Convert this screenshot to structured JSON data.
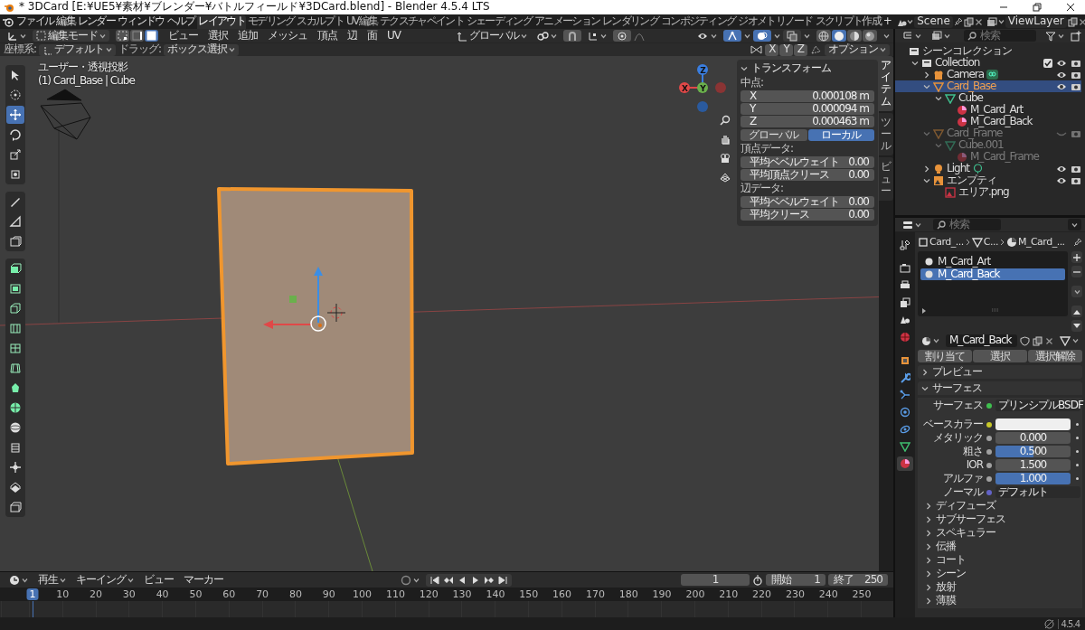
{
  "window": {
    "title": "* 3DCard [E:¥UE5¥素材¥ブレンダー¥バトルフィールド¥3DCard.blend] - Blender 4.5.4 LTS"
  },
  "menu": [
    "ファイル",
    "編集",
    "レンダー",
    "ウィンドウ",
    "ヘルプ"
  ],
  "workspaces": [
    {
      "label": "レイアウト",
      "selected": true
    },
    {
      "label": "モデリング",
      "selected": false
    },
    {
      "label": "スカルプト",
      "selected": false
    },
    {
      "label": "UV編集",
      "selected": false
    },
    {
      "label": "テクスチャペイント",
      "selected": false
    },
    {
      "label": "シェーディング",
      "selected": false
    },
    {
      "label": "アニメーション",
      "selected": false
    },
    {
      "label": "レンダリング",
      "selected": false
    },
    {
      "label": "コンポジティング",
      "selected": false
    },
    {
      "label": "ジオメトリノード",
      "selected": false
    },
    {
      "label": "スクリプト作成",
      "selected": false
    }
  ],
  "add_workspace": "+",
  "scene": {
    "name": "Scene"
  },
  "view_layer": {
    "name": "ViewLayer"
  },
  "viewport_header": {
    "mode": "編集モード",
    "select_modes": [
      {
        "kind": "vertex",
        "selected": false
      },
      {
        "kind": "edge",
        "selected": false
      },
      {
        "kind": "face",
        "selected": true
      }
    ],
    "menus": [
      "ビュー",
      "選択",
      "追加",
      "メッシュ",
      "頂点",
      "辺",
      "面",
      "UV"
    ],
    "orientation": "グローバル",
    "snapping": {
      "on": false
    },
    "proportional_editing": {
      "on": false
    },
    "view_toggles": [
      {
        "kind": "gizmo",
        "on": true
      },
      {
        "kind": "overlay",
        "on": true
      },
      {
        "kind": "xray",
        "on": false
      }
    ],
    "shading": [
      {
        "kind": "wireframe",
        "selected": false
      },
      {
        "kind": "solid",
        "selected": true
      },
      {
        "kind": "material",
        "selected": false
      },
      {
        "kind": "rendered",
        "selected": false
      }
    ]
  },
  "tool_settings": {
    "coordinate_label": "座標系:",
    "coordinate_value": "デフォルト",
    "drag_label": "ドラッグ:",
    "drag_value": "ボックス選択",
    "mirror_axes": [
      {
        "label": "X",
        "selected": false
      },
      {
        "label": "Y",
        "selected": false
      },
      {
        "label": "Z",
        "selected": false
      }
    ],
    "options": "オプション"
  },
  "viewport": {
    "view_name": "ユーザー・透視投影",
    "object_info": "(1) Card_Base | Cube",
    "gizmo_axes": [
      "X",
      "Y",
      "Z"
    ]
  },
  "tool_groups": [
    [
      {
        "selected": false
      },
      {
        "selected": false
      },
      {
        "selected": true
      },
      {
        "selected": false
      },
      {
        "selected": false
      },
      {
        "selected": false
      }
    ],
    [
      {
        "selected": false
      },
      {
        "selected": false
      },
      {
        "selected": false
      }
    ],
    [
      {
        "selected": false
      },
      {
        "selected": false
      },
      {
        "selected": false
      },
      {
        "selected": false
      },
      {
        "selected": false
      },
      {
        "selected": false
      },
      {
        "selected": false
      },
      {
        "selected": false
      },
      {
        "selected": false
      },
      {
        "selected": false
      },
      {
        "selected": false
      },
      {
        "selected": false
      },
      {
        "selected": false
      }
    ]
  ],
  "n_panel": {
    "title": "トランスフォーム",
    "median_label": "中点:",
    "median": [
      {
        "axis": "X",
        "value": "0.000108 m"
      },
      {
        "axis": "Y",
        "value": "0.000094 m"
      },
      {
        "axis": "Z",
        "value": "0.000463 m"
      }
    ],
    "space": [
      {
        "label": "グローバル",
        "selected": false
      },
      {
        "label": "ローカル",
        "selected": true
      }
    ],
    "sections": [
      {
        "title": "頂点データ:",
        "fields": [
          {
            "label": "平均ベベルウェイト",
            "value": "0.00"
          },
          {
            "label": "平均頂点クリース",
            "value": "0.00"
          }
        ]
      },
      {
        "title": "辺データ:",
        "fields": [
          {
            "label": "平均ベベルウェイト",
            "value": "0.00"
          },
          {
            "label": "平均クリース",
            "value": "0.00"
          }
        ]
      }
    ]
  },
  "side_tabs": [
    {
      "label": "アイテム",
      "selected": true
    },
    {
      "label": "ツール",
      "selected": false
    },
    {
      "label": "ビュー",
      "selected": false
    }
  ],
  "outliner": {
    "search": {
      "placeholder": "検索"
    },
    "root": "シーンコレクション",
    "tree": [
      {
        "label": "Collection",
        "kind": "collection",
        "expanded": true,
        "selected": false,
        "checked": true,
        "visible": true,
        "children": [
          {
            "label": "Camera",
            "kind": "camera",
            "expanded": false,
            "selected": false,
            "visible": true
          },
          {
            "label": "Card_Base",
            "kind": "mesh_object",
            "expanded": true,
            "selected": true,
            "visible": true,
            "children": [
              {
                "label": "Cube",
                "kind": "mesh_data",
                "expanded": true,
                "selected": false,
                "children": [
                  {
                    "label": "M_Card_Art",
                    "kind": "material",
                    "selected": false
                  },
                  {
                    "label": "M_Card_Back",
                    "kind": "material",
                    "selected": false
                  }
                ]
              }
            ]
          },
          {
            "label": "Card_Frame",
            "kind": "mesh_object",
            "expanded": true,
            "selected": false,
            "visible": false,
            "children": [
              {
                "label": "Cube.001",
                "kind": "mesh_data",
                "expanded": true,
                "selected": false,
                "children": [
                  {
                    "label": "M_Card_Frame",
                    "kind": "material",
                    "selected": false
                  }
                ]
              }
            ]
          },
          {
            "label": "Light",
            "kind": "light",
            "expanded": false,
            "selected": false,
            "visible": true
          },
          {
            "label": "エンプティ",
            "kind": "empty",
            "expanded": true,
            "selected": false,
            "visible": true,
            "children": [
              {
                "label": "エリア.png",
                "kind": "image",
                "selected": false
              }
            ]
          }
        ]
      }
    ]
  },
  "properties": {
    "search": {
      "placeholder": "検索"
    },
    "tabs": [
      {
        "kind": "tool",
        "selected": false
      },
      {
        "kind": "render",
        "selected": false
      },
      {
        "kind": "output",
        "selected": false
      },
      {
        "kind": "view_layer",
        "selected": false
      },
      {
        "kind": "scene",
        "selected": false
      },
      {
        "kind": "world",
        "selected": false
      },
      {
        "kind": "object",
        "selected": false
      },
      {
        "kind": "modifier",
        "selected": false
      },
      {
        "kind": "particles",
        "selected": false
      },
      {
        "kind": "physics",
        "selected": false
      },
      {
        "kind": "constraints",
        "selected": false
      },
      {
        "kind": "data",
        "selected": false
      },
      {
        "kind": "material",
        "selected": true
      }
    ],
    "breadcrumb": [
      "Card_...",
      "C...",
      "M_Card_..."
    ],
    "material_slots": [
      {
        "label": "M_Card_Art",
        "selected": false
      },
      {
        "label": "M_Card_Back",
        "selected": true
      }
    ],
    "material_name": "M_Card_Back",
    "slot_buttons": [
      "割り当て",
      "選択",
      "選択解除"
    ],
    "panels": [
      {
        "title": "プレビュー",
        "expanded": false
      },
      {
        "title": "サーフェス",
        "expanded": true,
        "rows": [
          {
            "kind": "shader",
            "label": "サーフェス",
            "value": "プリンシプルBSDF",
            "color": "#3fbf4f"
          },
          {
            "kind": "color",
            "label": "ベースカラー",
            "swatch": {
              "color": "#efefef"
            },
            "color": "#c7c729"
          },
          {
            "kind": "slider",
            "label": "メタリック",
            "value": "0.000",
            "level": 0,
            "color": "#a1a1a1"
          },
          {
            "kind": "slider",
            "label": "粗さ",
            "value": "0.500",
            "level": 0.5,
            "color": "#a1a1a1"
          },
          {
            "kind": "number",
            "label": "IOR",
            "value": "1.500",
            "color": "#a1a1a1"
          },
          {
            "kind": "slider",
            "label": "アルファ",
            "value": "1.000",
            "level": 1,
            "color": "#a1a1a1"
          },
          {
            "kind": "link",
            "label": "ノーマル",
            "value": "デフォルト",
            "color": "#6363c7"
          }
        ],
        "subpanels": [
          {
            "title": "ディフューズ",
            "expanded": false
          },
          {
            "title": "サブサーフェス",
            "expanded": false
          },
          {
            "title": "スペキュラー",
            "expanded": false
          },
          {
            "title": "伝播",
            "expanded": false
          },
          {
            "title": "コート",
            "expanded": false
          },
          {
            "title": "シーン",
            "expanded": false
          },
          {
            "title": "放射",
            "expanded": false
          },
          {
            "title": "薄膜",
            "expanded": false
          }
        ]
      }
    ]
  },
  "timeline": {
    "menus": [
      {
        "label": "再生",
        "kind": "dropdown"
      },
      {
        "label": "キーイング",
        "kind": "dropdown"
      },
      {
        "label": "ビュー",
        "kind": "menu"
      },
      {
        "label": "マーカー",
        "kind": "menu"
      }
    ],
    "current_frame": "1",
    "start_label": "開始",
    "start": "1",
    "end_label": "終了",
    "end": "250",
    "ruler": [
      {
        "label": "1",
        "selected": true
      },
      {
        "label": "10",
        "selected": false
      },
      {
        "label": "20",
        "selected": false
      },
      {
        "label": "30",
        "selected": false
      },
      {
        "label": "40",
        "selected": false
      },
      {
        "label": "50",
        "selected": false
      },
      {
        "label": "60",
        "selected": false
      },
      {
        "label": "70",
        "selected": false
      },
      {
        "label": "80",
        "selected": false
      },
      {
        "label": "90",
        "selected": false
      },
      {
        "label": "100",
        "selected": false
      },
      {
        "label": "110",
        "selected": false
      },
      {
        "label": "120",
        "selected": false
      },
      {
        "label": "130",
        "selected": false
      },
      {
        "label": "140",
        "selected": false
      },
      {
        "label": "150",
        "selected": false
      },
      {
        "label": "160",
        "selected": false
      },
      {
        "label": "170",
        "selected": false
      },
      {
        "label": "180",
        "selected": false
      },
      {
        "label": "190",
        "selected": false
      },
      {
        "label": "200",
        "selected": false
      },
      {
        "label": "210",
        "selected": false
      },
      {
        "label": "220",
        "selected": false
      },
      {
        "label": "230",
        "selected": false
      },
      {
        "label": "240",
        "selected": false
      },
      {
        "label": "250",
        "selected": false
      }
    ]
  },
  "status": {
    "version": "4.5.4"
  }
}
